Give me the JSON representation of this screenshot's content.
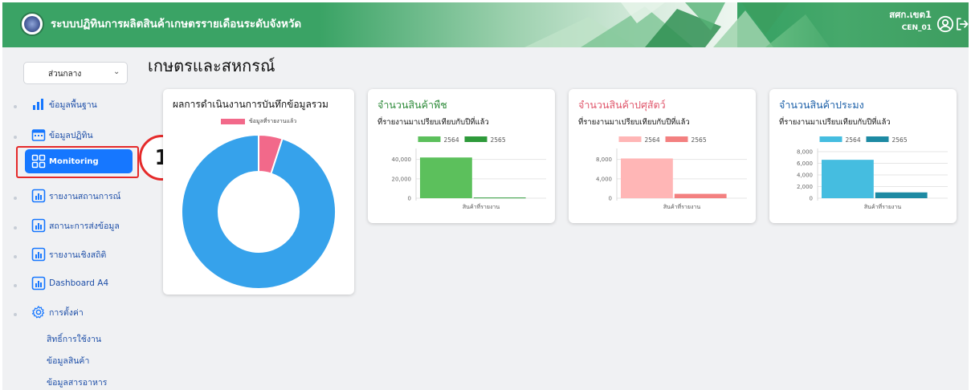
{
  "header": {
    "title": "ระบบปฏิทินการผลิตสินค้าเกษตรรายเดือนระดับจังหวัด",
    "user_name": "สศก.เขต1",
    "user_code": "CEN_01",
    "icons": [
      "logo",
      "user-circle-icon",
      "logout-icon"
    ]
  },
  "sidebar": {
    "select_value": "ส่วนกลาง",
    "items": [
      {
        "label": "ข้อมูลพื้นฐาน",
        "icon": "bar-chart-icon"
      },
      {
        "label": "ข้อมูลปฏิทิน",
        "icon": "calendar-icon"
      },
      {
        "label": "Monitoring",
        "icon": "grid-icon",
        "active": true
      },
      {
        "label": "รายงานสถานการณ์",
        "icon": "report-chart-icon"
      },
      {
        "label": "สถานะการส่งข้อมูล",
        "icon": "report-chart-icon"
      },
      {
        "label": "รายงานเชิงสถิติ",
        "icon": "report-chart-icon"
      },
      {
        "label": "Dashboard A4",
        "icon": "report-chart-icon"
      },
      {
        "label": "การตั้งค่า",
        "icon": "gear-icon"
      }
    ],
    "sub_items": [
      "สิทธิ์การใช้งาน",
      "ข้อมูลสินค้า",
      "ข้อมูลสารอาหาร"
    ],
    "step_badge": "1"
  },
  "main": {
    "page_title": "เกษตรและสหกรณ์"
  },
  "colors": {
    "header_green": "#3aa365",
    "active_blue": "#1677ff",
    "highlight_red": "#e52a2a",
    "donut_blue": "#36a2eb",
    "donut_pink": "#ff6384"
  },
  "chart_data": [
    {
      "type": "pie",
      "title": "ผลการดำเนินงานการบันทึกข้อมูลรวม",
      "labels": [
        "ข้อมูลที่รายงานแล้ว",
        ""
      ],
      "values": [
        5,
        95
      ],
      "colors": [
        "#f2698a",
        "#36a2eb"
      ],
      "legend": "top"
    },
    {
      "type": "bar",
      "title": "จำนวนสินค้าพืช",
      "subtitle": "ที่รายงานมาเปรียบเทียบกับปีที่แล้ว",
      "categories": [
        "สินค้าที่รายงาน"
      ],
      "series": [
        {
          "name": "2564",
          "values": [
            42000
          ],
          "color": "#5cc05c"
        },
        {
          "name": "2565",
          "values": [
            700
          ],
          "color": "#2e9a3a"
        }
      ],
      "yticks": [
        "0",
        "20,000",
        "40,000"
      ],
      "ylim": [
        0,
        48000
      ],
      "title_color": "#2e8b3a"
    },
    {
      "type": "bar",
      "title": "จำนวนสินค้าปศุสัตว์",
      "subtitle": "ที่รายงานมาเปรียบเทียบกับปีที่แล้ว",
      "categories": [
        "สินค้าที่รายงาน"
      ],
      "series": [
        {
          "name": "2564",
          "values": [
            8200
          ],
          "color": "#ffb6b6"
        },
        {
          "name": "2565",
          "values": [
            900
          ],
          "color": "#f38080"
        }
      ],
      "yticks": [
        "0",
        "4,000",
        "8,000"
      ],
      "ylim": [
        0,
        9600
      ],
      "title_color": "#e0566b"
    },
    {
      "type": "bar",
      "title": "จำนวนสินค้าประมง",
      "subtitle": "ที่รายงานมาเปรียบเทียบกับปีที่แล้ว",
      "categories": [
        "สินค้าที่รายงาน"
      ],
      "series": [
        {
          "name": "2564",
          "values": [
            6600
          ],
          "color": "#45bde0"
        },
        {
          "name": "2565",
          "values": [
            1000
          ],
          "color": "#1d8aa3"
        }
      ],
      "yticks": [
        "0",
        "2,000",
        "4,000",
        "6,000",
        "8,000"
      ],
      "ylim": [
        0,
        8000
      ],
      "title_color": "#1b5fa8"
    }
  ]
}
